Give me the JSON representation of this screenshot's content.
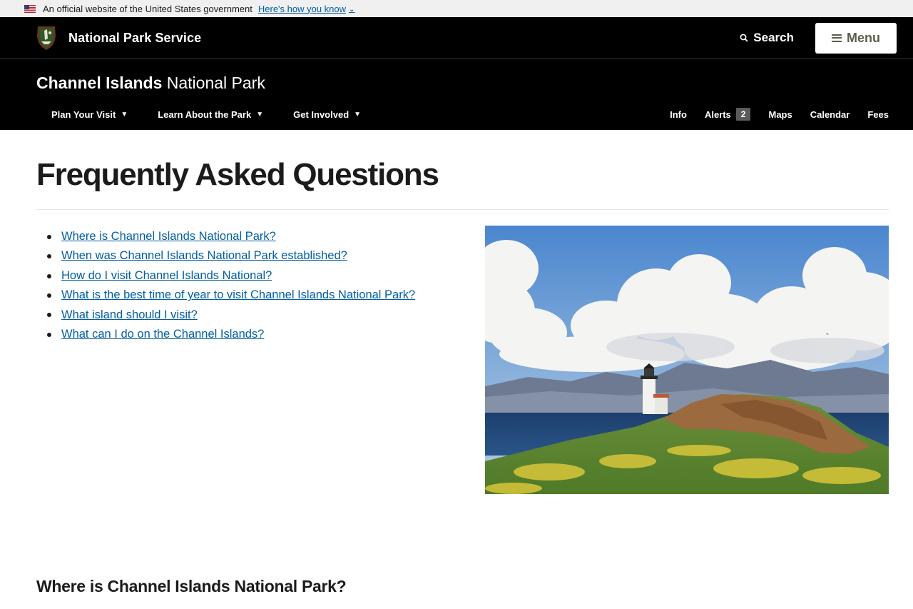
{
  "gov_banner": {
    "text": "An official website of the United States government",
    "link": "Here's how you know"
  },
  "header": {
    "agency": "National Park Service",
    "search_label": "Search",
    "menu_label": "Menu"
  },
  "park": {
    "name_bold": "Channel Islands",
    "name_light": "National Park"
  },
  "park_nav": {
    "primary": [
      {
        "label": "Plan Your Visit"
      },
      {
        "label": "Learn About the Park"
      },
      {
        "label": "Get Involved"
      }
    ],
    "utility": {
      "info": "Info",
      "alerts": "Alerts",
      "alerts_count": "2",
      "maps": "Maps",
      "calendar": "Calendar",
      "fees": "Fees"
    }
  },
  "main": {
    "title": "Frequently Asked Questions",
    "faq_links": [
      "Where is Channel Islands National Park?",
      "When was Channel Islands National Park established?",
      "How do I visit Channel Islands National?",
      "What is the best time of year to visit Channel Islands National Park?",
      "What island should I visit?",
      "What can I do on the Channel Islands?"
    ],
    "section_heading": "Where is Channel Islands National Park?"
  },
  "colors": {
    "black": "#000000",
    "link": "#005ea2",
    "badge": "#5b5b5b",
    "menu_text": "#5e5e4e",
    "banner_bg": "#f0f0f0"
  }
}
